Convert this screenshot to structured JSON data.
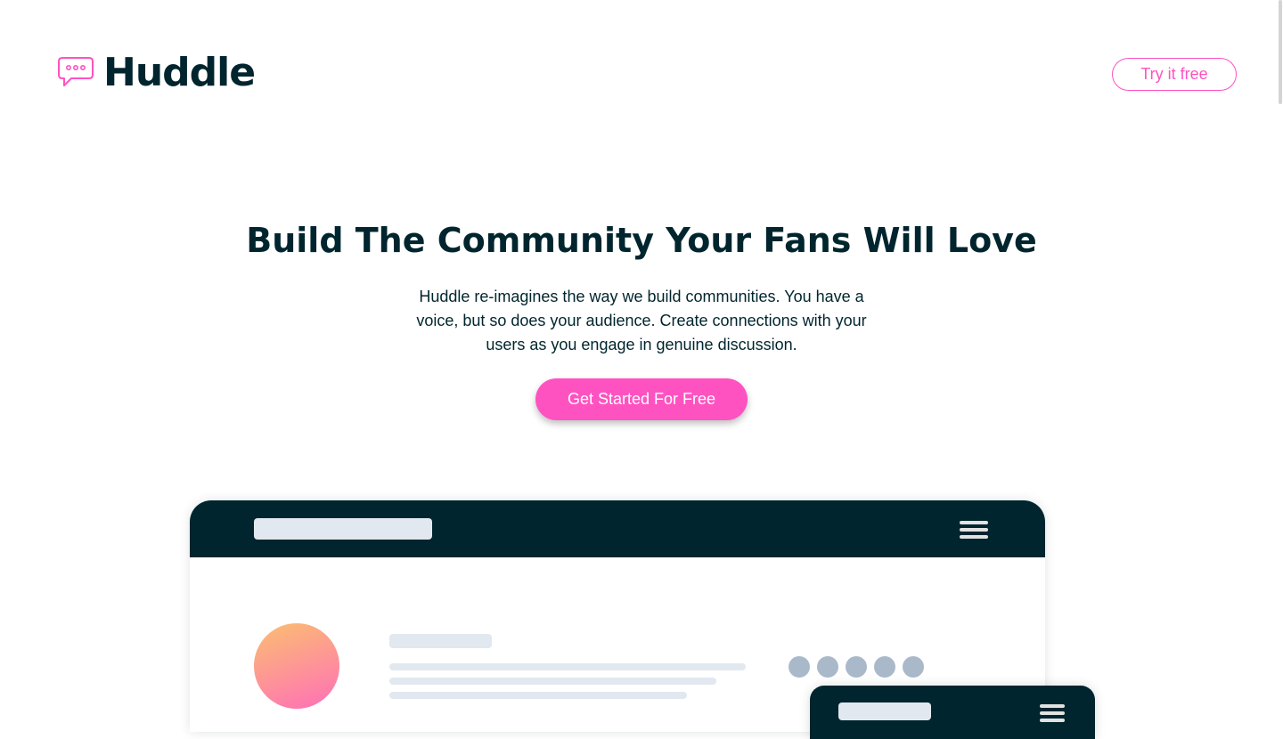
{
  "brand": {
    "name": "Huddle",
    "accent_color": "#ff52c1",
    "dark_color": "#00252e"
  },
  "header": {
    "logo_text": "Huddle",
    "logo_icon": "chat-bubble-icon",
    "try_button_label": "Try it free"
  },
  "hero": {
    "title": "Build The Community Your Fans Will Love",
    "description": "Huddle re-imagines the way we build communities. You have a voice, but so does your audience. Create connections with your users as you engage in genuine discussion.",
    "cta_label": "Get Started For Free"
  },
  "mockup": {
    "menu_icon": "hamburger-icon",
    "dot_count": 5
  }
}
